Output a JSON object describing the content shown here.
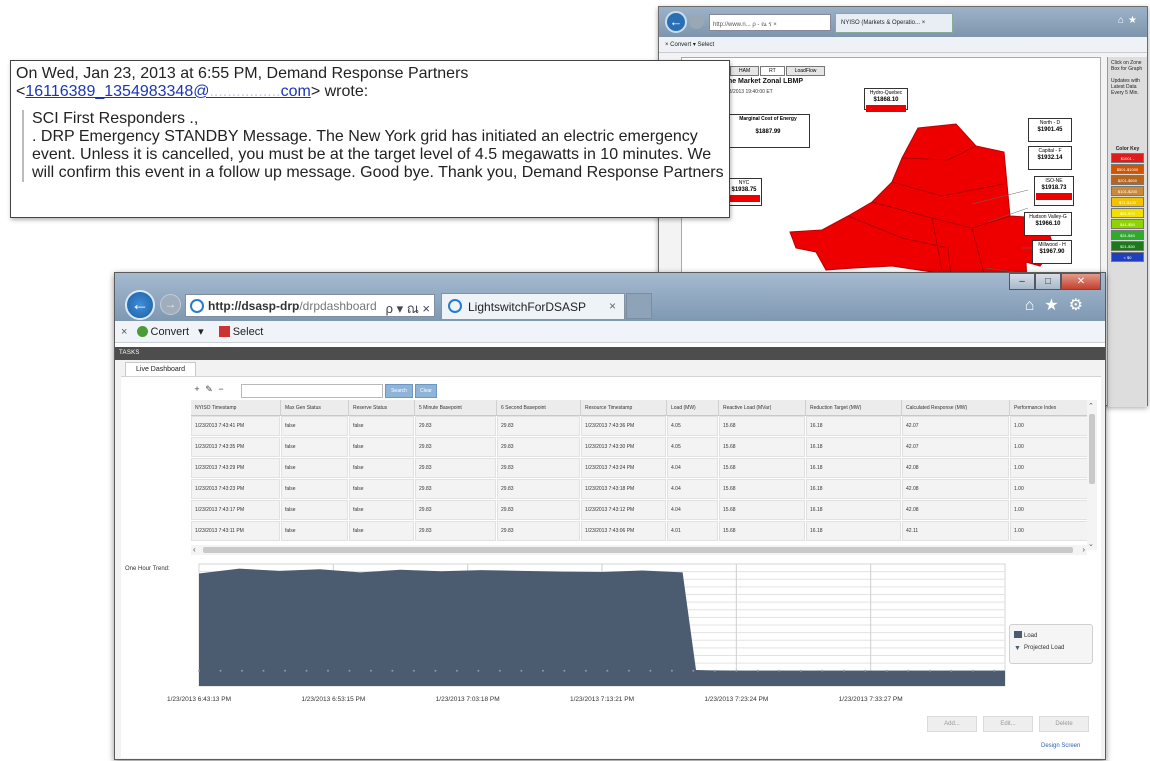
{
  "background_window": {
    "address": "http://www.n... ρ - ณ ร ×",
    "tab": "NYISO (Markets & Operatio... ×",
    "command_bar": "×  Convert  ▾  Select",
    "tabs": [
      "HAM",
      "RT",
      "LoadFlow"
    ],
    "title": "me Market Zonal LBMP",
    "subtitle": "23/2013 19:40:00 ET",
    "hydro_label": "Hydro-Quebec",
    "hydro_value": "$1868.10",
    "marginal_label": "Marginal Cost of Energy",
    "marginal_value": "$1887.99",
    "north_label": "North - D",
    "north_value": "$1901.45",
    "capital_label": "Capital - F",
    "capital_value": "$1932.14",
    "isone_label": "ISO-NE",
    "isone_value": "$1918.73",
    "nyc_label": "NYC",
    "nyc_value": "$1938.75",
    "hudson_label": "Hudson Valley-G",
    "hudson_value": "$1966.10",
    "millwood_label": "Millwood - H",
    "millwood_value": "$1967.90",
    "side_text": "Click on Zone Box for Graph",
    "side_update": "Updates with Latest Data Every 5 Min.",
    "color_key_title": "Color Key",
    "color_key": [
      {
        "label": "$1001 -",
        "color": "#e01b1b"
      },
      {
        "label": "$501-$1000",
        "color": "#d35400"
      },
      {
        "label": "$201-$500",
        "color": "#b5651d"
      },
      {
        "label": "$101-$200",
        "color": "#c98a3b"
      },
      {
        "label": "$71-$100",
        "color": "#f2c300"
      },
      {
        "label": "$51-$70",
        "color": "#f0e000"
      },
      {
        "label": "$41-$50",
        "color": "#8fd400"
      },
      {
        "label": "$31-$40",
        "color": "#2faa2f"
      },
      {
        "label": "$21-$30",
        "color": "#1c7a1c"
      },
      {
        "label": "< $0",
        "color": "#1f3fbf"
      }
    ]
  },
  "email": {
    "header_pre": "On Wed, Jan 23, 2013 at 6:55 PM, Demand Response Partners",
    "header_lt": "<",
    "header_link": "16116389_1354983348@",
    "header_domain": "com",
    "header_post": "> wrote:",
    "line1": "SCI First Responders .,",
    "body": ". DRP Emergency STANDBY Message. The New York grid has initiated an electric emergency event. Unless it is cancelled, you must be at the target level of 4.5 megawatts in 10 minutes. We will confirm this event in a follow up message. Good bye. Thank you, Demand Response Partners"
  },
  "browser": {
    "address_bold": "http://dsasp-drp",
    "address_rest": "/drpdashboard",
    "address_ctrls": "ρ ▾ ณ ×",
    "tab_title": "LightswitchForDSASP",
    "tab_close": "×",
    "command_close": "×",
    "convert": "Convert",
    "select": "Select",
    "tools_icons": "⌂★⚙"
  },
  "app": {
    "tasks_label": "TASKS",
    "screen_tab": "Live Dashboard",
    "toolbar": {
      "add": "+",
      "edit": "✎",
      "remove": "−"
    },
    "search_button": "Search",
    "clear_button": "Clear",
    "grid": {
      "columns": [
        "NYISO Timestamp",
        "Max Gen Status",
        "Reserve Status",
        "5 Minute Basepoint",
        "6 Second Basepoint",
        "Resource Timestamp",
        "Load (MW)",
        "Reactive Load (MVar)",
        "Reduction Target (MW)",
        "Calculated Response (MW)",
        "Performance Index"
      ],
      "rows": [
        [
          "1/23/2013 7:43:41 PM",
          "false",
          "false",
          "29.83",
          "29.83",
          "1/23/2013 7:43:36 PM",
          "4.05",
          "15.68",
          "16.18",
          "42.07",
          "1.00"
        ],
        [
          "1/23/2013 7:43:35 PM",
          "false",
          "false",
          "29.83",
          "29.83",
          "1/23/2013 7:43:30 PM",
          "4.05",
          "15.68",
          "16.18",
          "42.07",
          "1.00"
        ],
        [
          "1/23/2013 7:43:29 PM",
          "false",
          "false",
          "29.83",
          "29.83",
          "1/23/2013 7:43:24 PM",
          "4.04",
          "15.68",
          "16.18",
          "42.08",
          "1.00"
        ],
        [
          "1/23/2013 7:43:23 PM",
          "false",
          "false",
          "29.83",
          "29.83",
          "1/23/2013 7:43:18 PM",
          "4.04",
          "15.68",
          "16.18",
          "42.08",
          "1.00"
        ],
        [
          "1/23/2013 7:43:17 PM",
          "false",
          "false",
          "29.83",
          "29.83",
          "1/23/2013 7:43:12 PM",
          "4.04",
          "15.68",
          "16.18",
          "42.08",
          "1.00"
        ],
        [
          "1/23/2013 7:43:11 PM",
          "false",
          "false",
          "29.83",
          "29.83",
          "1/23/2013 7:43:06 PM",
          "4.01",
          "15.68",
          "16.18",
          "42.11",
          "1.00"
        ]
      ]
    },
    "trend_label": "One Hour Trend:",
    "legend": {
      "load": "Load",
      "projected": "Projected Load"
    },
    "actions": {
      "add": "Add...",
      "edit": "Edit...",
      "delete": "Delete"
    },
    "design_screen": "Design Screen"
  },
  "chart_data": {
    "type": "area",
    "title": "",
    "xlabel": "",
    "ylabel": "",
    "x_tick_labels": [
      "1/23/2013 6:43:13 PM",
      "1/23/2013 6:53:15 PM",
      "1/23/2013 7:03:18 PM",
      "1/23/2013 7:13:21 PM",
      "1/23/2013 7:23:24 PM",
      "1/23/2013 7:33:27 PM"
    ],
    "x_minutes_from_start": [
      0,
      3,
      6,
      9,
      12,
      15,
      18,
      21,
      24,
      27,
      30,
      33,
      36,
      37,
      38,
      40,
      45,
      50,
      55,
      60
    ],
    "series": [
      {
        "name": "Load",
        "values": [
          29.5,
          30.8,
          30.2,
          30.6,
          29.8,
          30.5,
          30.1,
          30.4,
          30.2,
          30.0,
          29.9,
          30.3,
          29.8,
          4.2,
          4.1,
          4.05,
          4.05,
          4.04,
          4.04,
          4.05
        ]
      },
      {
        "name": "Projected Load",
        "values": [
          4.0,
          4.0,
          4.0,
          4.0,
          4.0,
          4.0,
          4.0,
          4.0,
          4.0,
          4.0,
          4.0,
          4.0,
          4.0,
          4.0,
          4.0,
          4.0,
          4.0,
          4.0,
          4.0,
          4.0
        ]
      }
    ],
    "ylim": [
      0,
      32
    ],
    "grid": true,
    "legend_position": "right",
    "colors": {
      "load": "#4b5b70",
      "projected": "#8c99a8"
    }
  }
}
